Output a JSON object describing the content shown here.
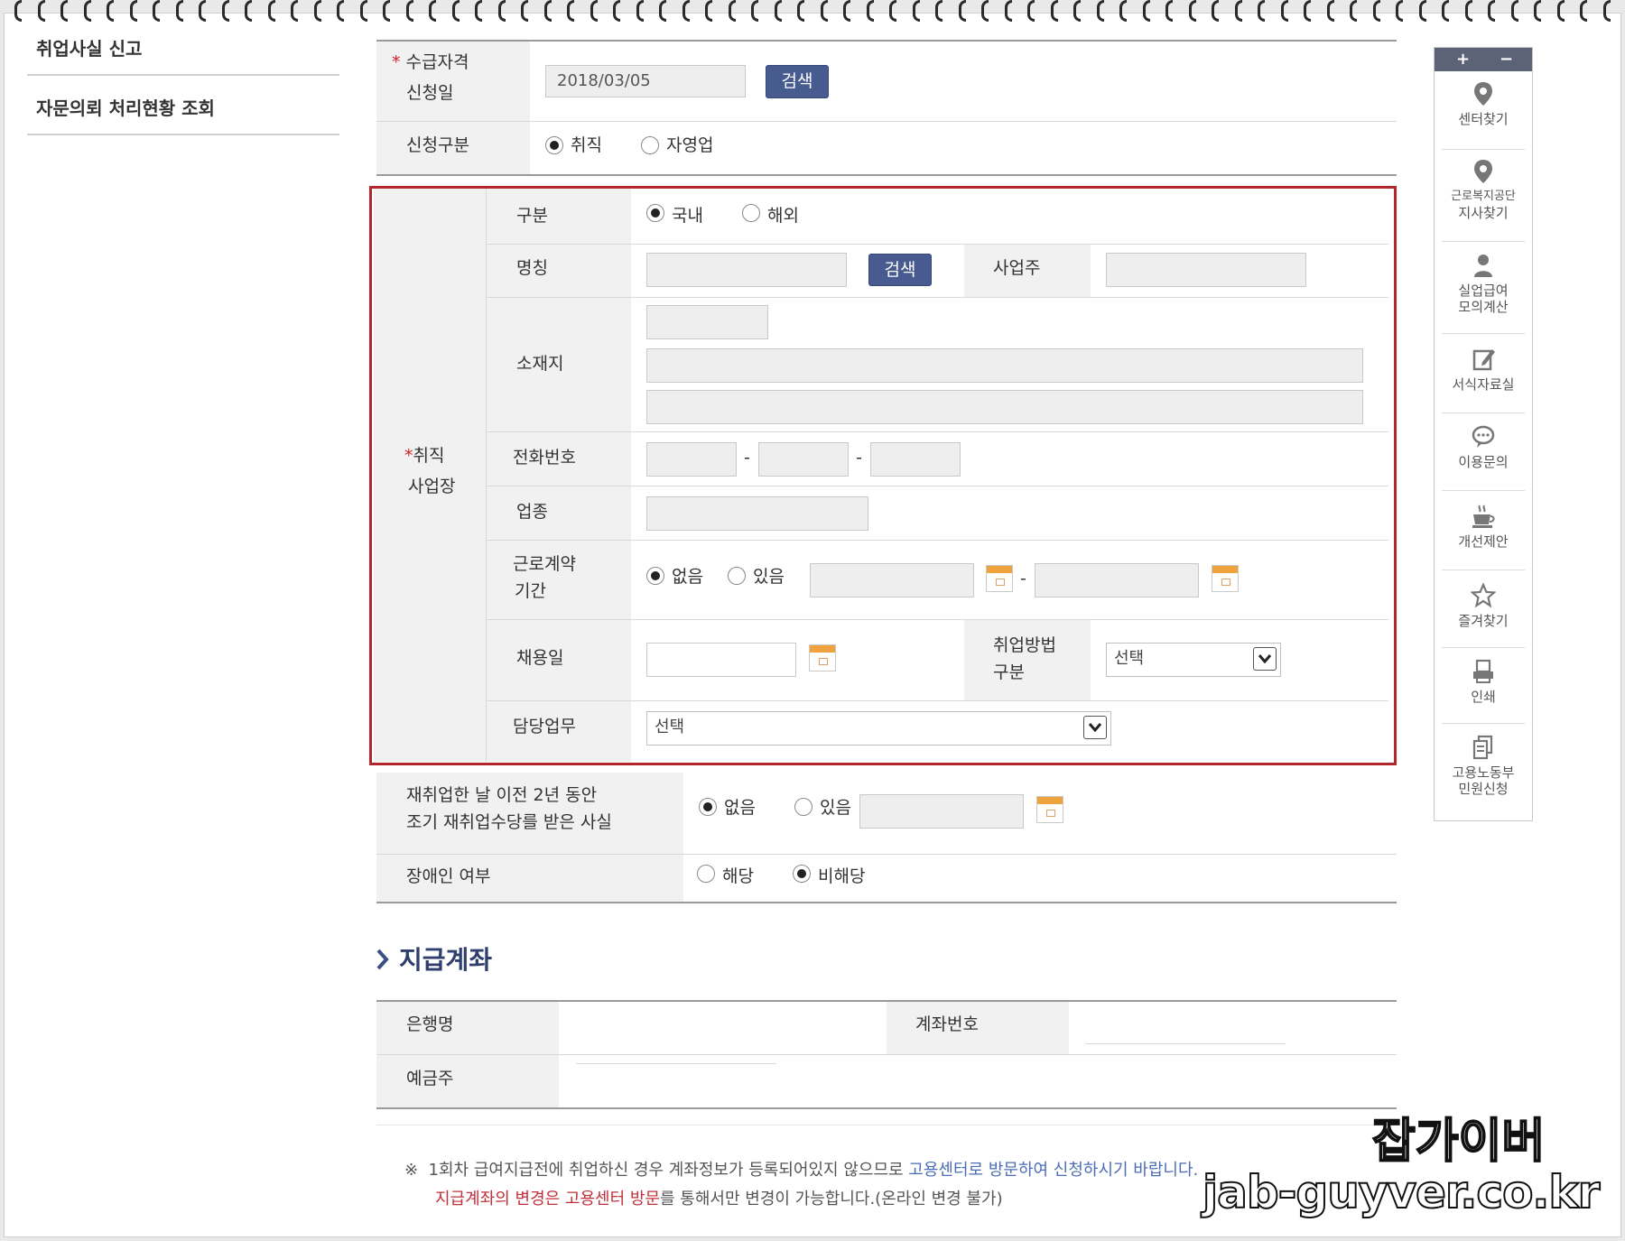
{
  "sidebar": {
    "items": [
      "취업사실 신고",
      "자문의뢰 처리현황 조회"
    ]
  },
  "form": {
    "apply_date": {
      "required_mark": "*",
      "label_line1": "수급자격",
      "label_line2": "신청일",
      "value": "2018/03/05",
      "search_label": "검색"
    },
    "apply_type": {
      "label": "신청구분",
      "options": [
        "취직",
        "자영업"
      ],
      "selected": "취직"
    },
    "workplace": {
      "required_mark": "*",
      "label_line1": "취직",
      "label_line2": "사업장",
      "division": {
        "label": "구분",
        "options": [
          "국내",
          "해외"
        ],
        "selected": "국내"
      },
      "name": {
        "label": "명칭",
        "search_label": "검색",
        "owner_label": "사업주"
      },
      "address": {
        "label": "소재지"
      },
      "phone": {
        "label": "전화번호",
        "separator": "-"
      },
      "industry": {
        "label": "업종"
      },
      "contract_period": {
        "label_line1": "근로계약",
        "label_line2": "기간",
        "options": [
          "없음",
          "있음"
        ],
        "selected": "없음",
        "separator": "-"
      },
      "hire_date": {
        "label": "채용일",
        "method_label_line1": "취업방법",
        "method_label_line2": "구분",
        "method_value": "선택"
      },
      "duty": {
        "label": "담당업무",
        "value": "선택"
      }
    },
    "early_reemployment": {
      "label_line1": "재취업한 날 이전 2년 동안",
      "label_line2": "조기 재취업수당를 받은 사실",
      "options": [
        "없음",
        "있음"
      ],
      "selected": "없음"
    },
    "disability": {
      "label": "장애인 여부",
      "options": [
        "해당",
        "비해당"
      ],
      "selected": "비해당"
    }
  },
  "account": {
    "section_title": "지급계좌",
    "bank_label": "은행명",
    "account_number_label": "계좌번호",
    "holder_label": "예금주"
  },
  "notice": {
    "mark": "※",
    "line1_a": "1회차 급여지급전에 취업하신 경우 계좌정보가 등록되어있지 않으므로 ",
    "line1_b": "고용센터로 방문하여 신청하시기 바랍니다.",
    "line2_a": "지급계좌의 변경은 고용센터 방문",
    "line2_b": "를 통해서만 변경이 가능합니다.(온라인 변경 불가)"
  },
  "quick_menu": {
    "plus": "+",
    "minus": "−",
    "items": [
      {
        "icon": "map-pin-icon",
        "line1": "센터찾기",
        "line2": ""
      },
      {
        "icon": "map-pin-icon",
        "line1": "근로복지공단",
        "line2": "지사찾기"
      },
      {
        "icon": "person-icon",
        "line1": "실업급여",
        "line2": "모의계산"
      },
      {
        "icon": "edit-icon",
        "line1": "서식자료실",
        "line2": ""
      },
      {
        "icon": "speech-bubble-icon",
        "line1": "이용문의",
        "line2": ""
      },
      {
        "icon": "coffee-cup-icon",
        "line1": "개선제안",
        "line2": ""
      },
      {
        "icon": "star-icon",
        "line1": "즐겨찾기",
        "line2": ""
      },
      {
        "icon": "printer-icon",
        "line1": "인쇄",
        "line2": ""
      },
      {
        "icon": "documents-icon",
        "line1": "고용노동부",
        "line2": "민원신청"
      }
    ]
  },
  "watermark": {
    "line1": "잡가이버",
    "line2": "jab-guyver.co.kr"
  },
  "colors": {
    "highlight_border": "#b3262d",
    "button": "#475b91",
    "label_bg": "#f1f1f1"
  }
}
